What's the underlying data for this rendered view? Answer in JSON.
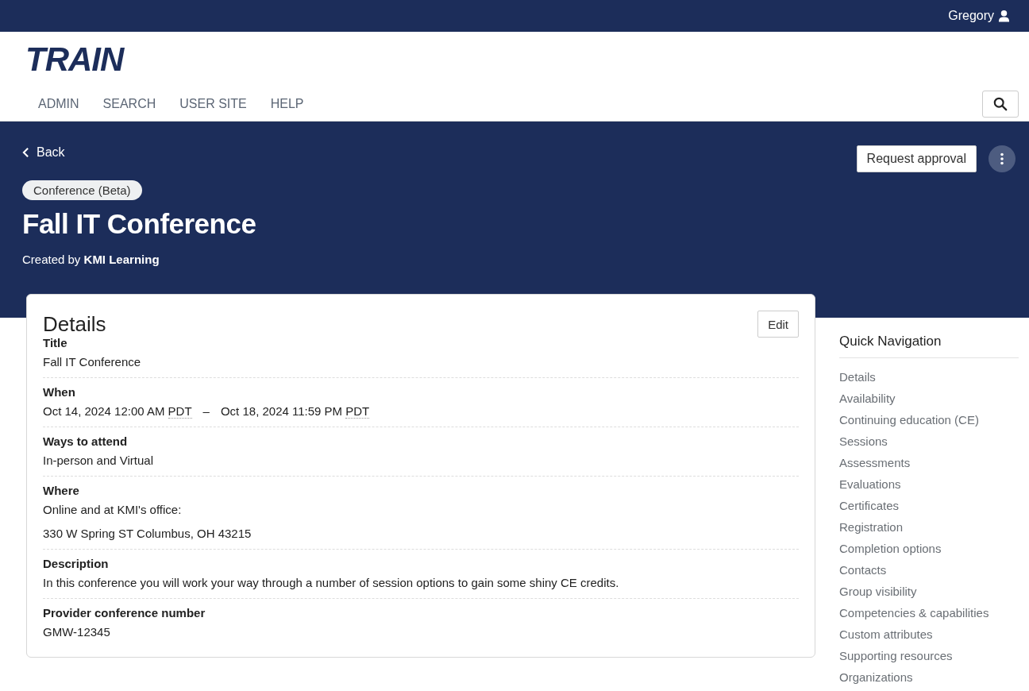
{
  "user_bar": {
    "user": "Gregory"
  },
  "header": {
    "logo": "TRAIN",
    "nav": [
      "ADMIN",
      "SEARCH",
      "USER SITE",
      "HELP"
    ]
  },
  "hero": {
    "back": "Back",
    "action": "Request approval",
    "badge": "Conference (Beta)",
    "title": "Fall IT Conference",
    "created_prefix": "Created by",
    "creator": "KMI Learning"
  },
  "details": {
    "heading": "Details",
    "edit": "Edit",
    "fields": [
      {
        "kind": "plain",
        "label": "Title",
        "values": [
          "Fall IT Conference"
        ]
      },
      {
        "kind": "range",
        "label": "When",
        "start": "Oct 14, 2024 12:00 AM",
        "start_tz": "PDT",
        "separator": "–",
        "end": "Oct 18, 2024 11:59 PM",
        "end_tz": "PDT"
      },
      {
        "kind": "plain",
        "label": "Ways to attend",
        "values": [
          "In-person and Virtual"
        ]
      },
      {
        "kind": "plain",
        "label": "Where",
        "values": [
          "Online and at KMI's office:",
          "330 W Spring ST Columbus, OH 43215"
        ]
      },
      {
        "kind": "plain",
        "label": "Description",
        "values": [
          "In this conference you will work your way through a number of session options to gain some shiny CE credits."
        ]
      },
      {
        "kind": "plain",
        "label": "Provider conference number",
        "values": [
          "GMW-12345"
        ]
      }
    ]
  },
  "quick_navigation": {
    "heading": "Quick Navigation",
    "items": [
      "Details",
      "Availability",
      "Continuing education (CE)",
      "Sessions",
      "Assessments",
      "Evaluations",
      "Certificates",
      "Registration",
      "Completion options",
      "Contacts",
      "Group visibility",
      "Competencies & capabilities",
      "Custom attributes",
      "Supporting resources",
      "Organizations"
    ]
  }
}
